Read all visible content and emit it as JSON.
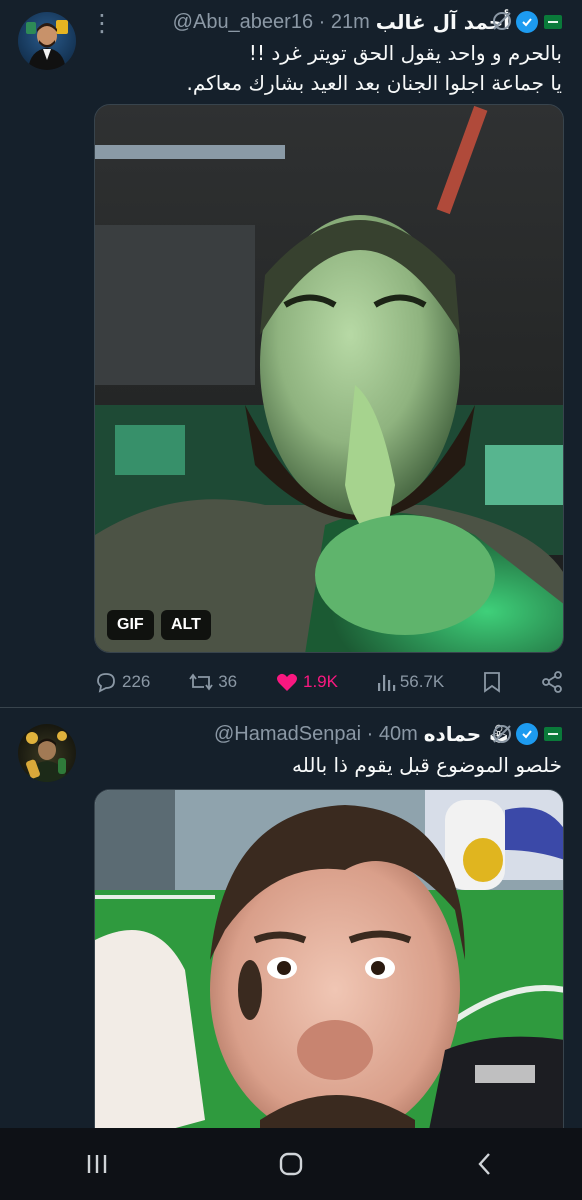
{
  "tweets": [
    {
      "display_name": "أحمد آل غالب",
      "handle": "@Abu_abeer16",
      "time": "· 21m",
      "text_line1": "بالحرم و واحد يقول الحق تويتر غرد !!",
      "text_line2": "يا جماعة اجلوا الجنان بعد العيد بشارك معاكم.",
      "media_badges": [
        "GIF",
        "ALT"
      ],
      "stats": {
        "replies": "226",
        "retweets": "36",
        "likes": "1.9K",
        "views": "56.7K"
      }
    },
    {
      "display_name": "حماده",
      "handle": "@HamadSenpai",
      "time": "· 40m",
      "text_line1": "خلصو الموضوع قبل يقوم ذا بالله"
    }
  ],
  "colors": {
    "background": "#15202b",
    "text": "#f7f9f9",
    "muted": "#8b98a5",
    "verified": "#1d9bf0",
    "like": "#f91880"
  },
  "icons": [
    "verified-badge-icon",
    "saudi-flag-icon",
    "grok-icon",
    "more-icon",
    "reply-icon",
    "retweet-icon",
    "heart-icon",
    "views-icon",
    "bookmark-icon",
    "share-icon",
    "nav-recents-icon",
    "nav-home-icon",
    "nav-back-icon"
  ]
}
